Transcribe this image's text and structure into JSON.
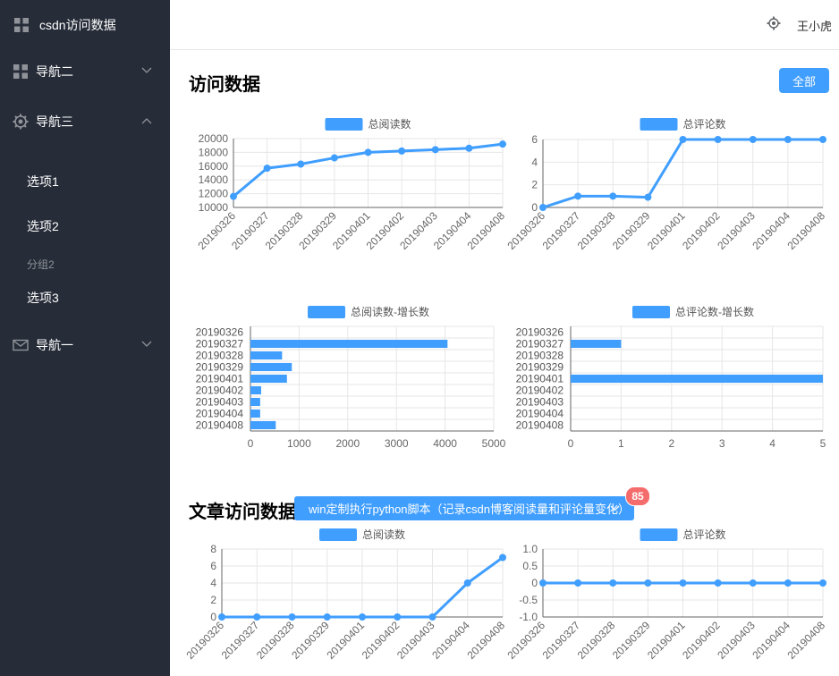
{
  "colors": {
    "sidebar_bg": "#262c38",
    "accent": "#409eff",
    "badge": "#f56c6c"
  },
  "sidebar": {
    "title": "csdn访问数据",
    "title_icon": "grid-icon",
    "nav2": {
      "label": "导航二",
      "icon": "grid-icon"
    },
    "nav3": {
      "label": "导航三",
      "icon": "gear-icon",
      "items": [
        "选项1",
        "选项2"
      ],
      "group": "分组2",
      "group_items": [
        "选项3"
      ]
    },
    "nav1": {
      "label": "导航一",
      "icon": "mail-icon"
    }
  },
  "header": {
    "user": "王小虎",
    "icon": "gear-icon"
  },
  "section1": {
    "title": "访问数据",
    "button": "全部"
  },
  "section2": {
    "title": "文章访问数据",
    "select": "win定制执行python脚本（记录csdn博客阅读量和评论量变化）",
    "badge": "85"
  },
  "chart_data": [
    {
      "id": "total-reads",
      "type": "line",
      "legend": "总阅读数",
      "categories": [
        "20190326",
        "20190327",
        "20190328",
        "20190329",
        "20190401",
        "20190402",
        "20190403",
        "20190404",
        "20190408"
      ],
      "values": [
        11600,
        15700,
        16300,
        17200,
        18000,
        18200,
        18400,
        18600,
        19200
      ],
      "ylim": [
        10000,
        20000
      ],
      "yticks": [
        10000,
        12000,
        14000,
        16000,
        18000,
        20000
      ]
    },
    {
      "id": "total-comments",
      "type": "line",
      "legend": "总评论数",
      "categories": [
        "20190326",
        "20190327",
        "20190328",
        "20190329",
        "20190401",
        "20190402",
        "20190403",
        "20190404",
        "20190408"
      ],
      "values": [
        0,
        1,
        1,
        0.9,
        6,
        6,
        6,
        6,
        6
      ],
      "ylim": [
        0,
        6
      ],
      "yticks": [
        0,
        2,
        4,
        6
      ]
    },
    {
      "id": "reads-growth",
      "type": "bar",
      "orientation": "horizontal",
      "legend": "总阅读数-增长数",
      "categories": [
        "20190326",
        "20190327",
        "20190328",
        "20190329",
        "20190401",
        "20190402",
        "20190403",
        "20190404",
        "20190408"
      ],
      "values": [
        0,
        4050,
        650,
        850,
        750,
        220,
        200,
        200,
        520
      ],
      "xlim": [
        0,
        5000
      ],
      "xticks": [
        0,
        1000,
        2000,
        3000,
        4000,
        5000
      ]
    },
    {
      "id": "comments-growth",
      "type": "bar",
      "orientation": "horizontal",
      "legend": "总评论数-增长数",
      "categories": [
        "20190326",
        "20190327",
        "20190328",
        "20190329",
        "20190401",
        "20190402",
        "20190403",
        "20190404",
        "20190408"
      ],
      "values": [
        0,
        1,
        0,
        0,
        5,
        0,
        0,
        0,
        0
      ],
      "xlim": [
        0,
        5
      ],
      "xticks": [
        0,
        1,
        2,
        3,
        4,
        5
      ]
    },
    {
      "id": "article-reads",
      "type": "line",
      "legend": "总阅读数",
      "categories": [
        "20190326",
        "20190327",
        "20190328",
        "20190329",
        "20190401",
        "20190402",
        "20190403",
        "20190404",
        "20190408"
      ],
      "values": [
        0,
        0,
        0,
        0,
        0,
        0,
        0,
        4,
        7
      ],
      "ylim": [
        0,
        8
      ],
      "yticks": [
        0,
        2,
        4,
        6,
        8
      ]
    },
    {
      "id": "article-comments",
      "type": "line",
      "legend": "总评论数",
      "categories": [
        "20190326",
        "20190327",
        "20190328",
        "20190329",
        "20190401",
        "20190402",
        "20190403",
        "20190404",
        "20190408"
      ],
      "values": [
        0,
        0,
        0,
        0,
        0,
        0,
        0,
        0,
        0
      ],
      "ylim": [
        -1.0,
        1.0
      ],
      "yticks": [
        -1.0,
        -0.5,
        0,
        0.5,
        1.0
      ],
      "ytick_labels": [
        "-1.0",
        "-0.5",
        "0",
        "0.5",
        "1.0"
      ]
    }
  ]
}
